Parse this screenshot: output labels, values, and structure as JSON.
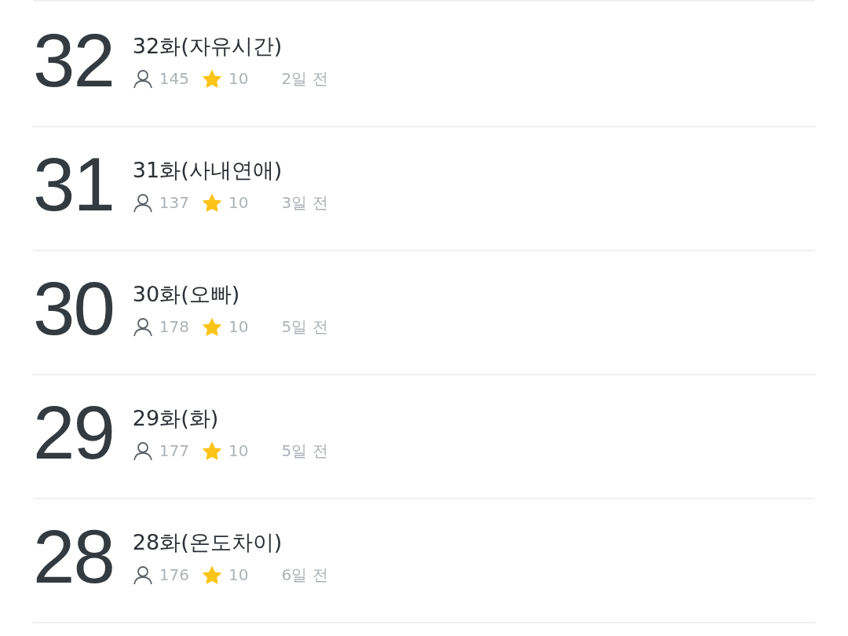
{
  "episodes": [
    {
      "number": "32",
      "title": "32화(자유시간)",
      "views": "145",
      "rating": "10",
      "date": "2일 전"
    },
    {
      "number": "31",
      "title": "31화(사내연애)",
      "views": "137",
      "rating": "10",
      "date": "3일 전"
    },
    {
      "number": "30",
      "title": "30화(오빠)",
      "views": "178",
      "rating": "10",
      "date": "5일 전"
    },
    {
      "number": "29",
      "title": "29화(화)",
      "views": "177",
      "rating": "10",
      "date": "5일 전"
    },
    {
      "number": "28",
      "title": "28화(온도차이)",
      "views": "176",
      "rating": "10",
      "date": "6일 전"
    }
  ]
}
